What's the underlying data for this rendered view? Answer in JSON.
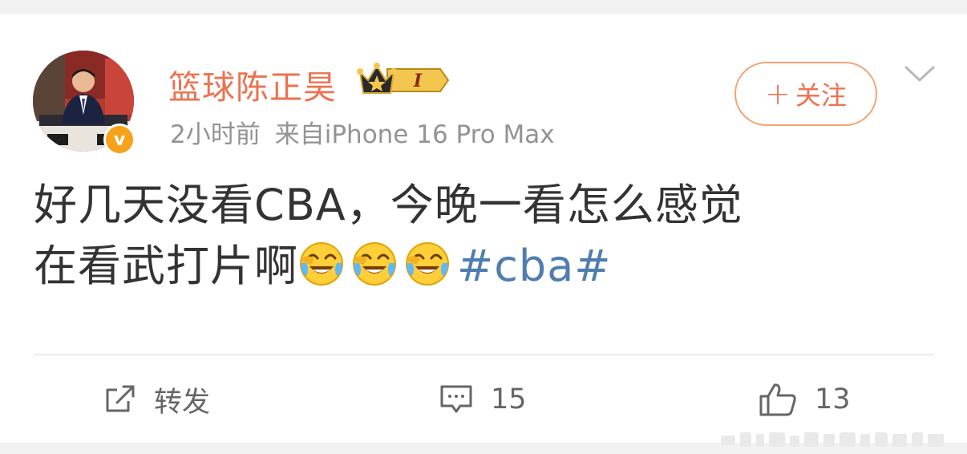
{
  "post": {
    "author": "篮球陈正昊",
    "level_badge": "I",
    "time": "2小时前",
    "source": "来自iPhone 16 Pro Max",
    "follow_label": "关注",
    "follow_plus": "+",
    "verified_badge": "v",
    "content_line1": "好几天没看CBA，今晚一看怎么感觉",
    "content_line2": "在看武打片啊",
    "emoji_name": "laugh-cry-emoji",
    "topic": "#cba#"
  },
  "actions": {
    "repost_label": "转发",
    "comment_count": "15",
    "like_count": "13"
  },
  "colors": {
    "username": "#eb7350",
    "topic": "#507daf",
    "meta": "#939393",
    "text": "#333333",
    "badge": "#f7a21b"
  }
}
